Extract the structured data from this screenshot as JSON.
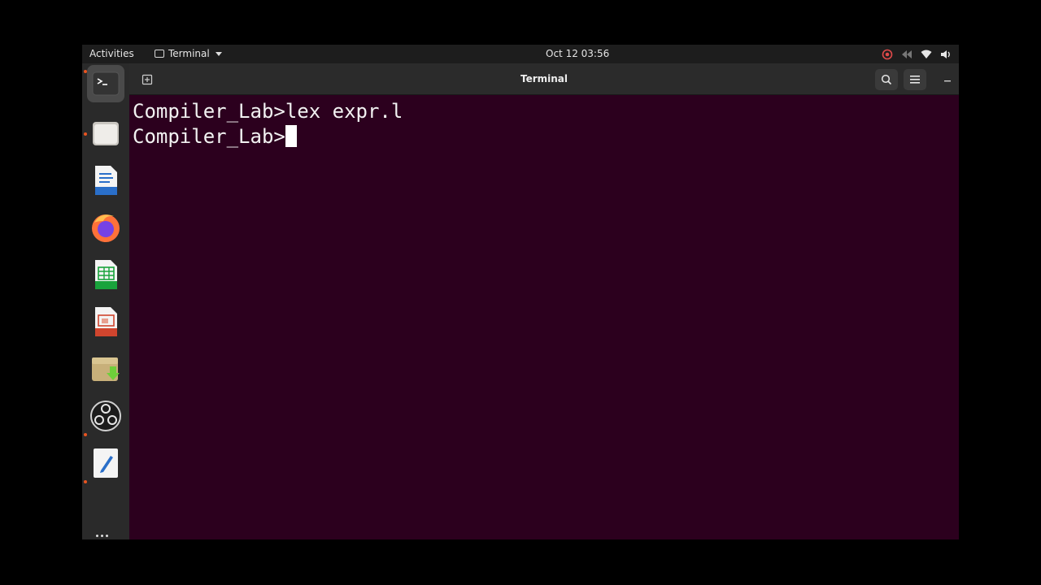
{
  "topbar": {
    "activities": "Activities",
    "app_menu": "Terminal",
    "clock": "Oct 12  03:56"
  },
  "window": {
    "title": "Terminal"
  },
  "terminal": {
    "lines": [
      "Compiler_Lab>lex expr.l",
      "Compiler_Lab>"
    ]
  },
  "dock": {
    "apps": [
      "terminal-icon",
      "files-icon",
      "writer-icon",
      "firefox-icon",
      "calc-icon",
      "impress-icon",
      "archive-icon",
      "obs-icon",
      "text-editor-icon"
    ]
  },
  "colors": {
    "terminal_bg": "#2c001e",
    "accent": "#e95420"
  }
}
